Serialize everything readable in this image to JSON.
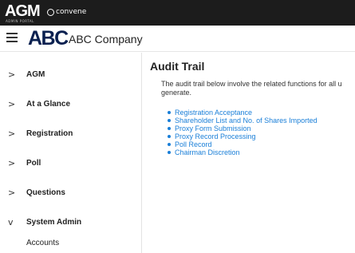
{
  "topbar": {
    "logo_text": "AGM",
    "logo_subtext": "ADMIN PORTAL",
    "partner_text": "convene"
  },
  "header": {
    "brand_logo": "ABC",
    "company_name": "ABC Company"
  },
  "sidebar": {
    "items": [
      {
        "label": "AGM",
        "chevron": ">"
      },
      {
        "label": "At a Glance",
        "chevron": ">"
      },
      {
        "label": "Registration",
        "chevron": ">"
      },
      {
        "label": "Poll",
        "chevron": ">"
      },
      {
        "label": "Questions",
        "chevron": ">"
      },
      {
        "label": "System Admin",
        "chevron": "v"
      }
    ],
    "sub_items": [
      "Accounts"
    ]
  },
  "main": {
    "title": "Audit Trail",
    "intro_line1": "The audit trail below involve the related functions for all u",
    "intro_line2": "generate.",
    "links": [
      "Registration Acceptance",
      "Shareholder List and No. of Shares Imported",
      "Proxy Form Submission",
      "Proxy Record Processing",
      "Poll Record",
      "Chairman Discretion"
    ]
  },
  "colors": {
    "topbar_bg": "#1c1c1c",
    "link": "#1a7fd8",
    "brand": "#0a2050"
  }
}
